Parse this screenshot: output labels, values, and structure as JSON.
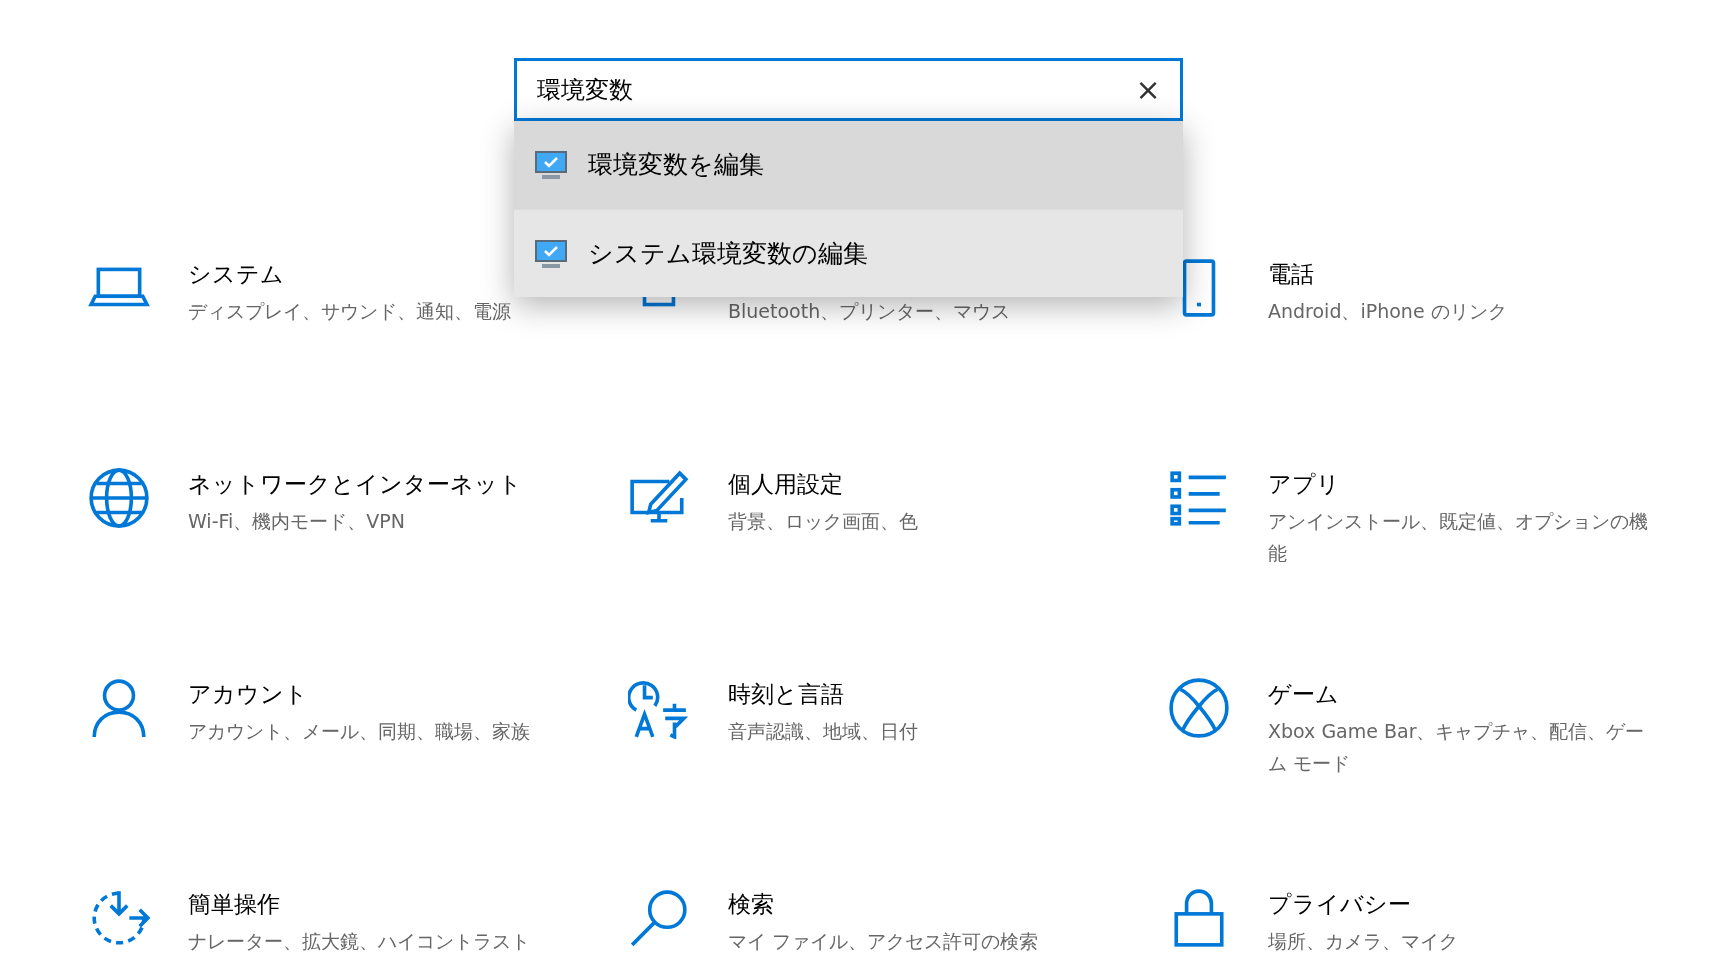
{
  "search": {
    "value": "環境変数",
    "clear": "×"
  },
  "suggestions": [
    {
      "label": "環境変数を編集",
      "selected": true
    },
    {
      "label": "システム環境変数の編集",
      "selected": false
    }
  ],
  "covered_tile": {
    "description": "Bluetooth、プリンター、マウス"
  },
  "tiles": [
    {
      "title": "システム",
      "description": "ディスプレイ、サウンド、通知、電源"
    },
    {
      "title": "電話",
      "description": "Android、iPhone のリンク"
    },
    {
      "title": "ネットワークとインターネット",
      "description": "Wi-Fi、機内モード、VPN"
    },
    {
      "title": "個人用設定",
      "description": "背景、ロック画面、色"
    },
    {
      "title": "アプリ",
      "description": "アンインストール、既定値、オプションの機能"
    },
    {
      "title": "アカウント",
      "description": "アカウント、メール、同期、職場、家族"
    },
    {
      "title": "時刻と言語",
      "description": "音声認識、地域、日付"
    },
    {
      "title": "ゲーム",
      "description": "Xbox Game Bar、キャプチャ、配信、ゲーム モード"
    },
    {
      "title": "簡単操作",
      "description": "ナレーター、拡大鏡、ハイコントラスト"
    },
    {
      "title": "検索",
      "description": "マイ ファイル、アクセス許可の検索"
    },
    {
      "title": "プライバシー",
      "description": "場所、カメラ、マイク"
    }
  ]
}
